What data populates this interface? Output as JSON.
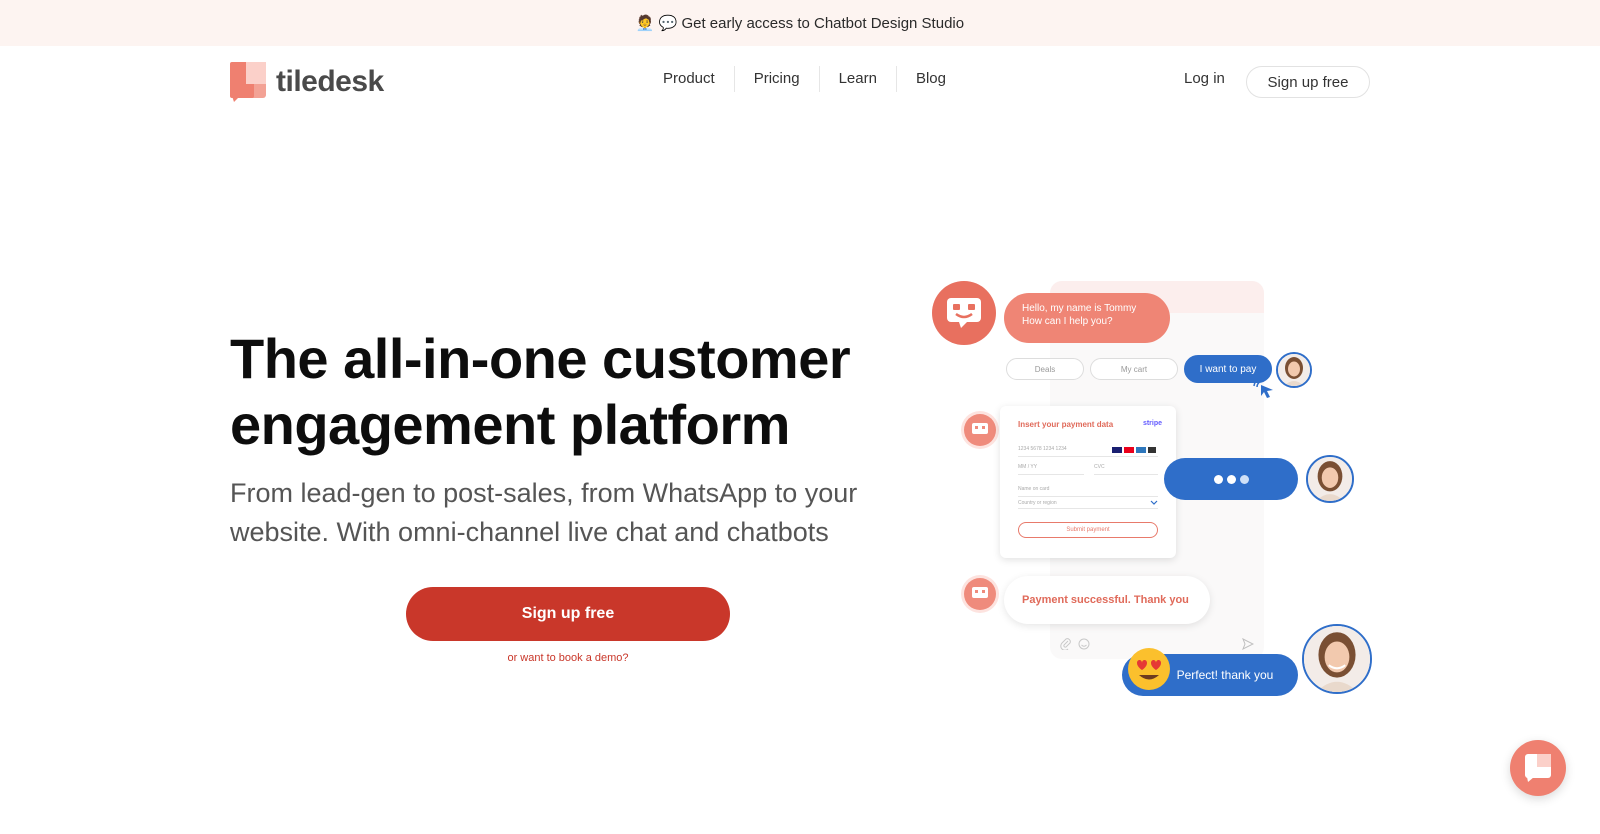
{
  "announcement": {
    "emoji": "🧑‍💼 💬",
    "text": "Get early access to Chatbot Design Studio"
  },
  "brand": {
    "name": "tiledesk",
    "accent": "#ef8070",
    "cta_color": "#c9372a",
    "chat_blue": "#2f6ec9"
  },
  "nav": {
    "items": [
      {
        "label": "Product"
      },
      {
        "label": "Pricing"
      },
      {
        "label": "Learn"
      },
      {
        "label": "Blog"
      }
    ],
    "login_label": "Log in",
    "signup_label": "Sign up free"
  },
  "hero": {
    "title_line1": "The all-in-one customer",
    "title_line2": "engagement platform",
    "subtitle": "From lead-gen to post-sales, from WhatsApp to your website. With omni-channel live chat and chatbots",
    "cta_label": "Sign up free",
    "demo_link": "or want to book a demo?"
  },
  "illustration": {
    "greeting_line1": "Hello, my name is Tommy",
    "greeting_line2": "How can I help you?",
    "chips": [
      "Deals",
      "My cart",
      "I want to pay"
    ],
    "payment_title": "Insert your payment data",
    "payment_brand": "stripe",
    "card_number": "1234 5678 1234 1234",
    "expiry": "MM / YY",
    "cvc": "CVC",
    "name_on_card": "Name on card",
    "country": "Country or region",
    "submit_label": "Submit payment",
    "success_text": "Payment successful. Thank you",
    "user_reply": "Perfect! thank you"
  },
  "icons": {
    "logo": "tiledesk-logo-icon",
    "chat_widget": "chat-widget-icon",
    "bot": "bot-face-icon",
    "cursor": "click-cursor-icon",
    "attach": "paperclip-icon",
    "emoji": "smiley-icon",
    "send": "send-icon"
  }
}
